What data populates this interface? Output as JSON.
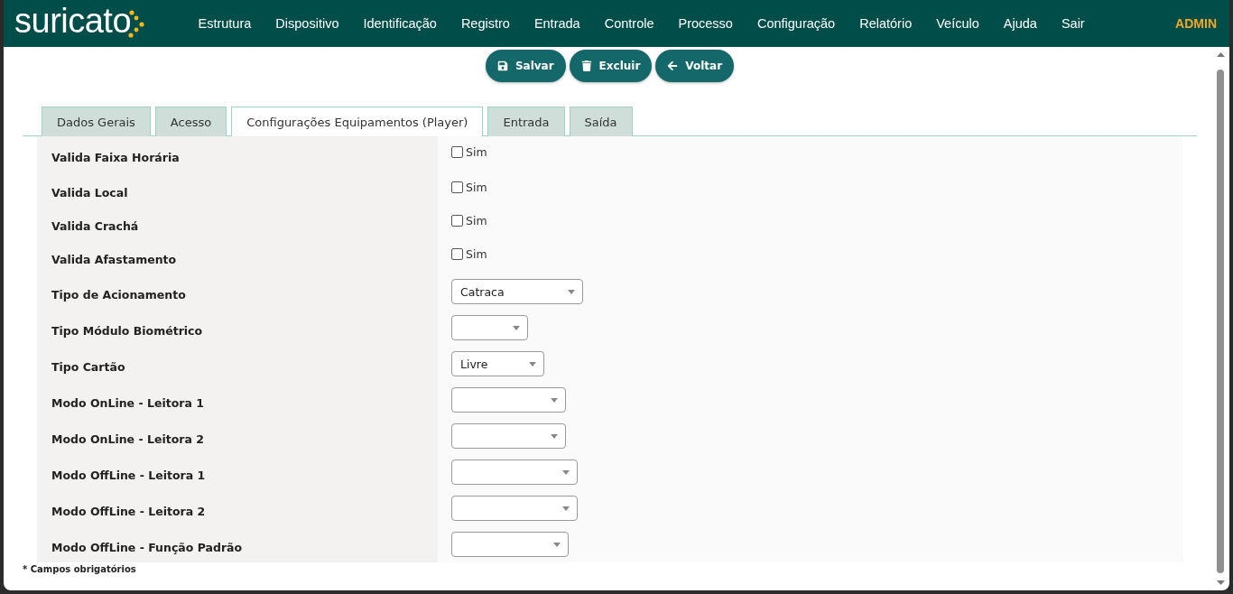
{
  "header": {
    "logo": "suricato",
    "menu": [
      "Estrutura",
      "Dispositivo",
      "Identificação",
      "Registro",
      "Entrada",
      "Controle",
      "Processo",
      "Configuração",
      "Relatório",
      "Veículo",
      "Ajuda",
      "Sair"
    ],
    "user": "ADMIN"
  },
  "actions": [
    {
      "kind": "save",
      "label": "Salvar"
    },
    {
      "kind": "delete",
      "label": "Excluir"
    },
    {
      "kind": "back",
      "label": "Voltar"
    }
  ],
  "tabs": [
    {
      "label": "Dados Gerais",
      "selected": false
    },
    {
      "label": "Acesso",
      "selected": false
    },
    {
      "label": "Configurações Equipamentos (Player)",
      "selected": true
    },
    {
      "label": "Entrada",
      "selected": false
    },
    {
      "label": "Saída",
      "selected": false
    }
  ],
  "fields": [
    {
      "kind": "checkbox",
      "label": "Valida Faixa Horária",
      "option": "Sim",
      "checked": false
    },
    {
      "kind": "checkbox",
      "label": "Valida Local",
      "option": "Sim",
      "checked": false
    },
    {
      "kind": "checkbox",
      "label": "Valida Crachá",
      "option": "Sim",
      "checked": false
    },
    {
      "kind": "checkbox",
      "label": "Valida Afastamento",
      "option": "Sim",
      "checked": false
    },
    {
      "kind": "select",
      "label": "Tipo de Acionamento",
      "value": "Catraca"
    },
    {
      "kind": "select",
      "label": "Tipo Módulo Biométrico"
    },
    {
      "kind": "select",
      "label": "Tipo Cartão",
      "value": "Livre"
    },
    {
      "kind": "select",
      "label": "Modo OnLine - Leitora 1"
    },
    {
      "kind": "select",
      "label": "Modo OnLine - Leitora 2"
    },
    {
      "kind": "select",
      "label": "Modo OffLine - Leitora 1"
    },
    {
      "kind": "select",
      "label": "Modo OffLine - Leitora 2"
    },
    {
      "kind": "select",
      "label": "Modo OffLine - Função Padrão"
    }
  ],
  "footnote": "* Campos obrigatórios"
}
